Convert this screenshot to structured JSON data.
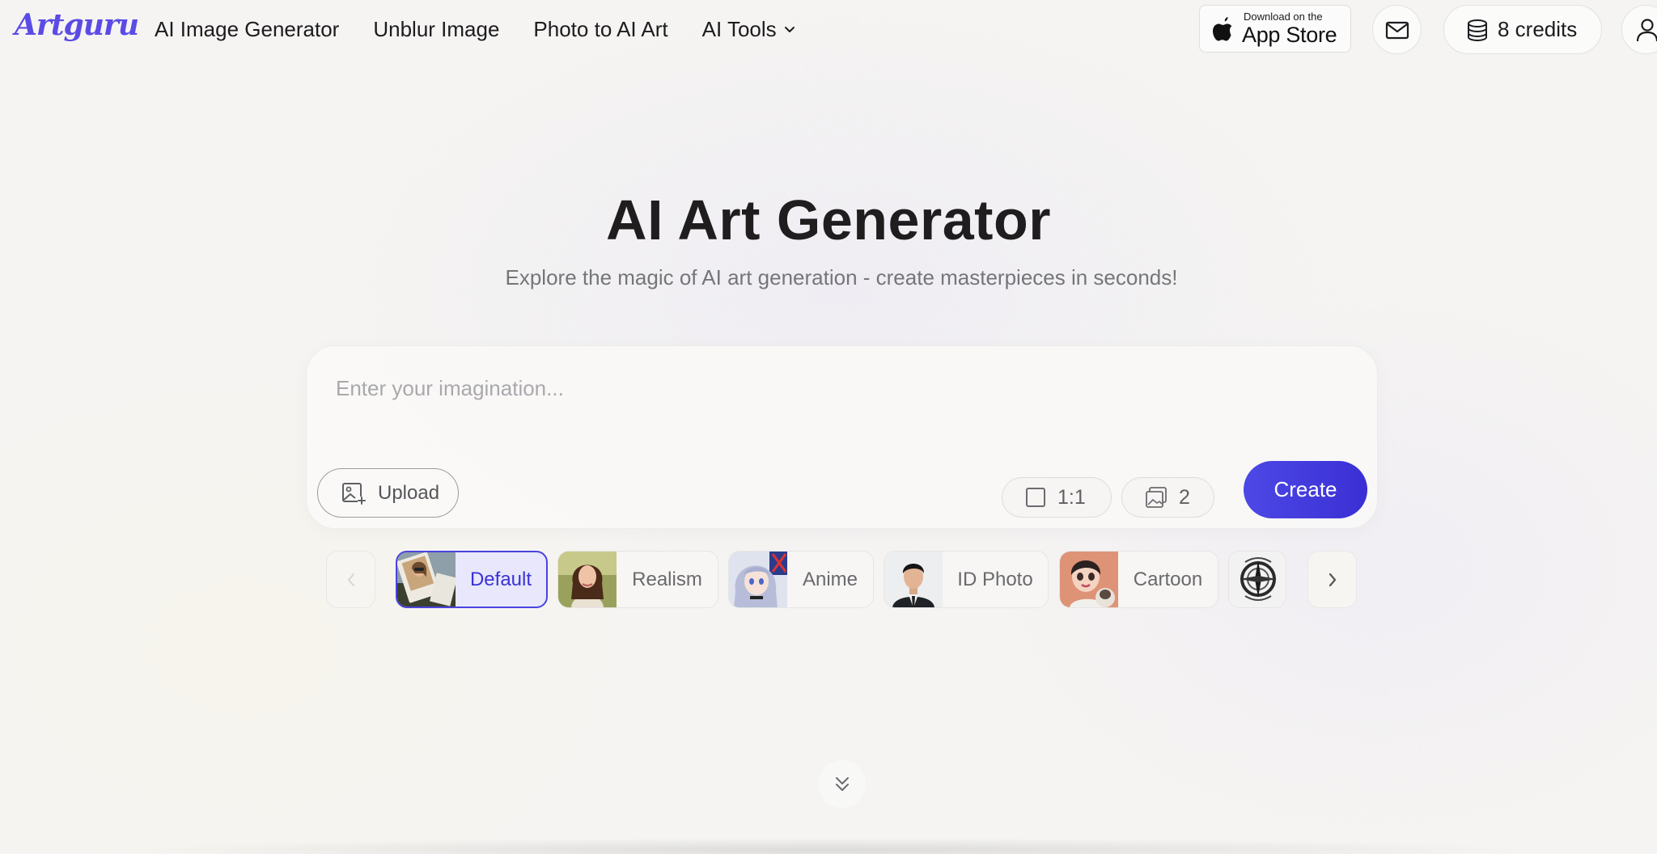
{
  "brand": {
    "logo_text": "Artguru",
    "accent_color": "#5b4be6"
  },
  "nav": {
    "items": [
      {
        "label": "AI Image Generator"
      },
      {
        "label": "Unblur Image"
      },
      {
        "label": "Photo to AI Art"
      },
      {
        "label": "AI Tools",
        "icon": "chevron-down-icon"
      }
    ]
  },
  "header_right": {
    "app_store": {
      "small_text": "Download on the",
      "big_text": "App Store",
      "icon": "apple-icon"
    },
    "mail_icon": "mail-icon",
    "credits": {
      "label": "8 credits",
      "icon": "coins-icon"
    },
    "user_icon": "user-icon"
  },
  "hero": {
    "title": "AI Art Generator",
    "subtitle": "Explore the magic of AI art generation - create masterpieces in seconds!"
  },
  "prompt": {
    "placeholder": "Enter your imagination...",
    "value": "",
    "upload_label": "Upload",
    "ratio_label": "1:1",
    "count_label": "2",
    "create_label": "Create",
    "create_color": "#4d48e6"
  },
  "styles": {
    "items": [
      {
        "label": "Default",
        "selected": true
      },
      {
        "label": "Realism",
        "selected": false
      },
      {
        "label": "Anime",
        "selected": false
      },
      {
        "label": "ID Photo",
        "selected": false
      },
      {
        "label": "Cartoon",
        "selected": false
      },
      {
        "label": "",
        "selected": false
      }
    ],
    "prev_icon": "chevron-left-icon",
    "next_icon": "chevron-right-icon"
  },
  "scroll_icon": "double-chevron-down-icon"
}
